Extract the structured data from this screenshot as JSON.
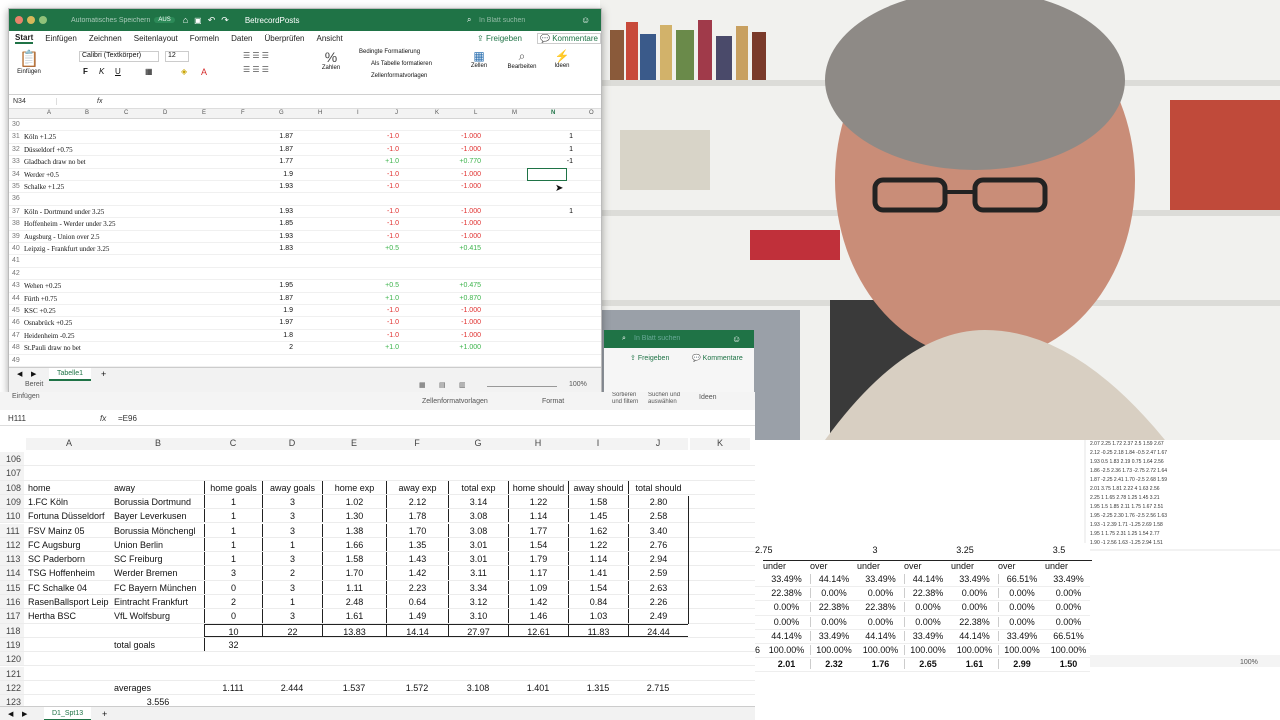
{
  "top_window": {
    "autosave": "Automatisches Speichern",
    "autosave_state": "AUS",
    "doc_title": "BetrecordPosts",
    "search_placeholder": "In Blatt suchen",
    "tabs": [
      "Start",
      "Einfügen",
      "Zeichnen",
      "Seitenlayout",
      "Formeln",
      "Daten",
      "Überprüfen",
      "Ansicht"
    ],
    "share": "Freigeben",
    "comments": "Kommentare",
    "ribbon": {
      "paste": "Einfügen",
      "font": "Calibri (Textkörper)",
      "size": "12",
      "bold": "F",
      "italic": "K",
      "underline": "U",
      "cond_format": "Bedingte Formatierung",
      "as_table": "Als Tabelle formatieren",
      "cell_styles": "Zellenformatvorlagen",
      "number": "Zahlen",
      "cells": "Zellen",
      "edit": "Bearbeiten",
      "ideas": "Ideen"
    },
    "name_box": "N34",
    "fx": "fx",
    "columns": [
      "A",
      "B",
      "C",
      "D",
      "E",
      "F",
      "G",
      "H",
      "I",
      "J",
      "K",
      "L",
      "M",
      "N",
      "O"
    ],
    "rows": [
      {
        "n": "30",
        "a": "",
        "g": "",
        "j": "",
        "l": "",
        "nv": ""
      },
      {
        "n": "31",
        "a": "Köln +1.25",
        "g": "1.87",
        "j": "-1.0",
        "l": "-1.000",
        "nv": "1"
      },
      {
        "n": "32",
        "a": "Düsseldorf +0.75",
        "g": "1.87",
        "j": "-1.0",
        "l": "-1.000",
        "nv": "1"
      },
      {
        "n": "33",
        "a": "Gladbach draw no bet",
        "g": "1.77",
        "j": "+1.0",
        "l": "+0.770",
        "nv": "-1"
      },
      {
        "n": "34",
        "a": "Werder +0.5",
        "g": "1.9",
        "j": "-1.0",
        "l": "-1.000",
        "nv": ""
      },
      {
        "n": "35",
        "a": "Schalke +1.25",
        "g": "1.93",
        "j": "-1.0",
        "l": "-1.000",
        "nv": ""
      },
      {
        "n": "36",
        "a": "",
        "g": "",
        "j": "",
        "l": "",
        "nv": ""
      },
      {
        "n": "37",
        "a": "Köln - Dortmund under 3.25",
        "g": "1.93",
        "j": "-1.0",
        "l": "-1.000",
        "nv": "1"
      },
      {
        "n": "38",
        "a": "Hoffenheim - Werder under 3.25",
        "g": "1.85",
        "j": "-1.0",
        "l": "-1.000",
        "nv": ""
      },
      {
        "n": "39",
        "a": "Augsburg - Union over 2.5",
        "g": "1.93",
        "j": "-1.0",
        "l": "-1.000",
        "nv": ""
      },
      {
        "n": "40",
        "a": "Leipzig - Frankfurt under 3.25",
        "g": "1.83",
        "j": "+0.5",
        "l": "+0.415",
        "nv": ""
      },
      {
        "n": "41",
        "a": "",
        "g": "",
        "j": "",
        "l": "",
        "nv": ""
      },
      {
        "n": "42",
        "a": "",
        "g": "",
        "j": "",
        "l": "",
        "nv": ""
      },
      {
        "n": "43",
        "a": "Wehen +0.25",
        "g": "1.95",
        "j": "+0.5",
        "l": "+0.475",
        "nv": ""
      },
      {
        "n": "44",
        "a": "Fürth +0.75",
        "g": "1.87",
        "j": "+1.0",
        "l": "+0.870",
        "nv": ""
      },
      {
        "n": "45",
        "a": "KSC +0.25",
        "g": "1.9",
        "j": "-1.0",
        "l": "-1.000",
        "nv": ""
      },
      {
        "n": "46",
        "a": "Osnabrück +0.25",
        "g": "1.97",
        "j": "-1.0",
        "l": "-1.000",
        "nv": ""
      },
      {
        "n": "47",
        "a": "Heidenheim -0.25",
        "g": "1.8",
        "j": "-1.0",
        "l": "-1.000",
        "nv": ""
      },
      {
        "n": "48",
        "a": "St.Pauli draw no bet",
        "g": "2",
        "j": "+1.0",
        "l": "+1.000",
        "nv": ""
      },
      {
        "n": "49",
        "a": "",
        "g": "",
        "j": "",
        "l": "",
        "nv": ""
      }
    ],
    "sheet_tab": "Tabelle1",
    "status": "Bereit",
    "zoom": "100%"
  },
  "main_window": {
    "name_box": "H111",
    "formula": "=E96",
    "fx": "fx",
    "cell_styles": "Zellenformatvorlagen",
    "format": "Format",
    "sort": "Sortieren und filtern",
    "find": "Suchen und auswählen",
    "ideas": "Ideen",
    "paste": "Einfügen",
    "columns": [
      "A",
      "B",
      "C",
      "D",
      "E",
      "F",
      "G",
      "H",
      "I",
      "J",
      "K"
    ],
    "rows": [
      {
        "n": "106",
        "cells": [
          "",
          "",
          "",
          "",
          "",
          "",
          "",
          "",
          "",
          ""
        ]
      },
      {
        "n": "107",
        "cells": [
          "",
          "",
          "",
          "",
          "",
          "",
          "",
          "",
          "",
          ""
        ]
      },
      {
        "n": "108",
        "cells": [
          "home",
          "away",
          "home goals",
          "away goals",
          "home exp",
          "away exp",
          "total exp",
          "home should",
          "away should",
          "total should"
        ]
      },
      {
        "n": "109",
        "cells": [
          "1.FC Köln",
          "Borussia Dortmund",
          "1",
          "3",
          "1.02",
          "2.12",
          "3.14",
          "1.22",
          "1.58",
          "2.80"
        ]
      },
      {
        "n": "110",
        "cells": [
          "Fortuna Düsseldorf",
          "Bayer Leverkusen",
          "1",
          "3",
          "1.30",
          "1.78",
          "3.08",
          "1.14",
          "1.45",
          "2.58"
        ]
      },
      {
        "n": "111",
        "cells": [
          "FSV Mainz 05",
          "Borussia Mönchengl",
          "1",
          "3",
          "1.38",
          "1.70",
          "3.08",
          "1.77",
          "1.62",
          "3.40"
        ]
      },
      {
        "n": "112",
        "cells": [
          "FC Augsburg",
          "Union Berlin",
          "1",
          "1",
          "1.66",
          "1.35",
          "3.01",
          "1.54",
          "1.22",
          "2.76"
        ]
      },
      {
        "n": "113",
        "cells": [
          "SC Paderborn",
          "SC Freiburg",
          "1",
          "3",
          "1.58",
          "1.43",
          "3.01",
          "1.79",
          "1.14",
          "2.94"
        ]
      },
      {
        "n": "114",
        "cells": [
          "TSG Hoffenheim",
          "Werder Bremen",
          "3",
          "2",
          "1.70",
          "1.42",
          "3.11",
          "1.17",
          "1.41",
          "2.59"
        ]
      },
      {
        "n": "115",
        "cells": [
          "FC Schalke 04",
          "FC Bayern München",
          "0",
          "3",
          "1.11",
          "2.23",
          "3.34",
          "1.09",
          "1.54",
          "2.63"
        ]
      },
      {
        "n": "116",
        "cells": [
          "RasenBallsport Leip",
          "Eintracht Frankfurt",
          "2",
          "1",
          "2.48",
          "0.64",
          "3.12",
          "1.42",
          "0.84",
          "2.26"
        ]
      },
      {
        "n": "117",
        "cells": [
          "Hertha BSC",
          "VfL Wolfsburg",
          "0",
          "3",
          "1.61",
          "1.49",
          "3.10",
          "1.46",
          "1.03",
          "2.49"
        ]
      },
      {
        "n": "118",
        "cells": [
          "",
          "",
          "10",
          "22",
          "13.83",
          "14.14",
          "27.97",
          "12.61",
          "11.83",
          "24.44"
        ]
      },
      {
        "n": "119",
        "cells": [
          "",
          "total goals",
          "32",
          "",
          "",
          "",
          "",
          "",
          "",
          ""
        ]
      },
      {
        "n": "120",
        "cells": [
          "",
          "",
          "",
          "",
          "",
          "",
          "",
          "",
          "",
          ""
        ]
      },
      {
        "n": "121",
        "cells": [
          "",
          "",
          "",
          "",
          "",
          "",
          "",
          "",
          "",
          ""
        ]
      },
      {
        "n": "122",
        "cells": [
          "",
          "averages",
          "1.111",
          "2.444",
          "1.537",
          "1.572",
          "3.108",
          "1.401",
          "1.315",
          "2.715"
        ]
      },
      {
        "n": "123",
        "cells": [
          "",
          "3.556",
          "",
          "",
          "",
          "",
          "",
          "",
          "",
          ""
        ]
      }
    ],
    "sheet_tab": "D1_Spt13"
  },
  "side_table": {
    "headers": [
      "2.75",
      "3",
      "3.25",
      "3.5"
    ],
    "sub": [
      "under",
      "over",
      "under",
      "over",
      "under",
      "over",
      "under"
    ],
    "rows": [
      [
        "33.49%",
        "44.14%",
        "33.49%",
        "44.14%",
        "33.49%",
        "66.51%",
        "33.49%"
      ],
      [
        "22.38%",
        "0.00%",
        "0.00%",
        "22.38%",
        "0.00%",
        "0.00%",
        "0.00%"
      ],
      [
        "0.00%",
        "22.38%",
        "22.38%",
        "0.00%",
        "0.00%",
        "0.00%",
        "0.00%"
      ],
      [
        "0.00%",
        "0.00%",
        "0.00%",
        "0.00%",
        "22.38%",
        "0.00%",
        "0.00%"
      ],
      [
        "44.14%",
        "33.49%",
        "44.14%",
        "33.49%",
        "44.14%",
        "33.49%",
        "66.51%"
      ],
      [
        "100.00%",
        "100.00%",
        "100.00%",
        "100.00%",
        "100.00%",
        "100.00%",
        "100.00%"
      ],
      [
        "2.01",
        "2.32",
        "1.76",
        "2.65",
        "1.61",
        "2.99",
        "1.50"
      ]
    ],
    "left_marks": [
      "",
      "",
      "",
      "",
      "",
      "6",
      ""
    ]
  },
  "overlay": {
    "search_placeholder": "In Blatt suchen",
    "share": "Freigeben",
    "comments": "Kommentare",
    "zoom": "100%"
  }
}
